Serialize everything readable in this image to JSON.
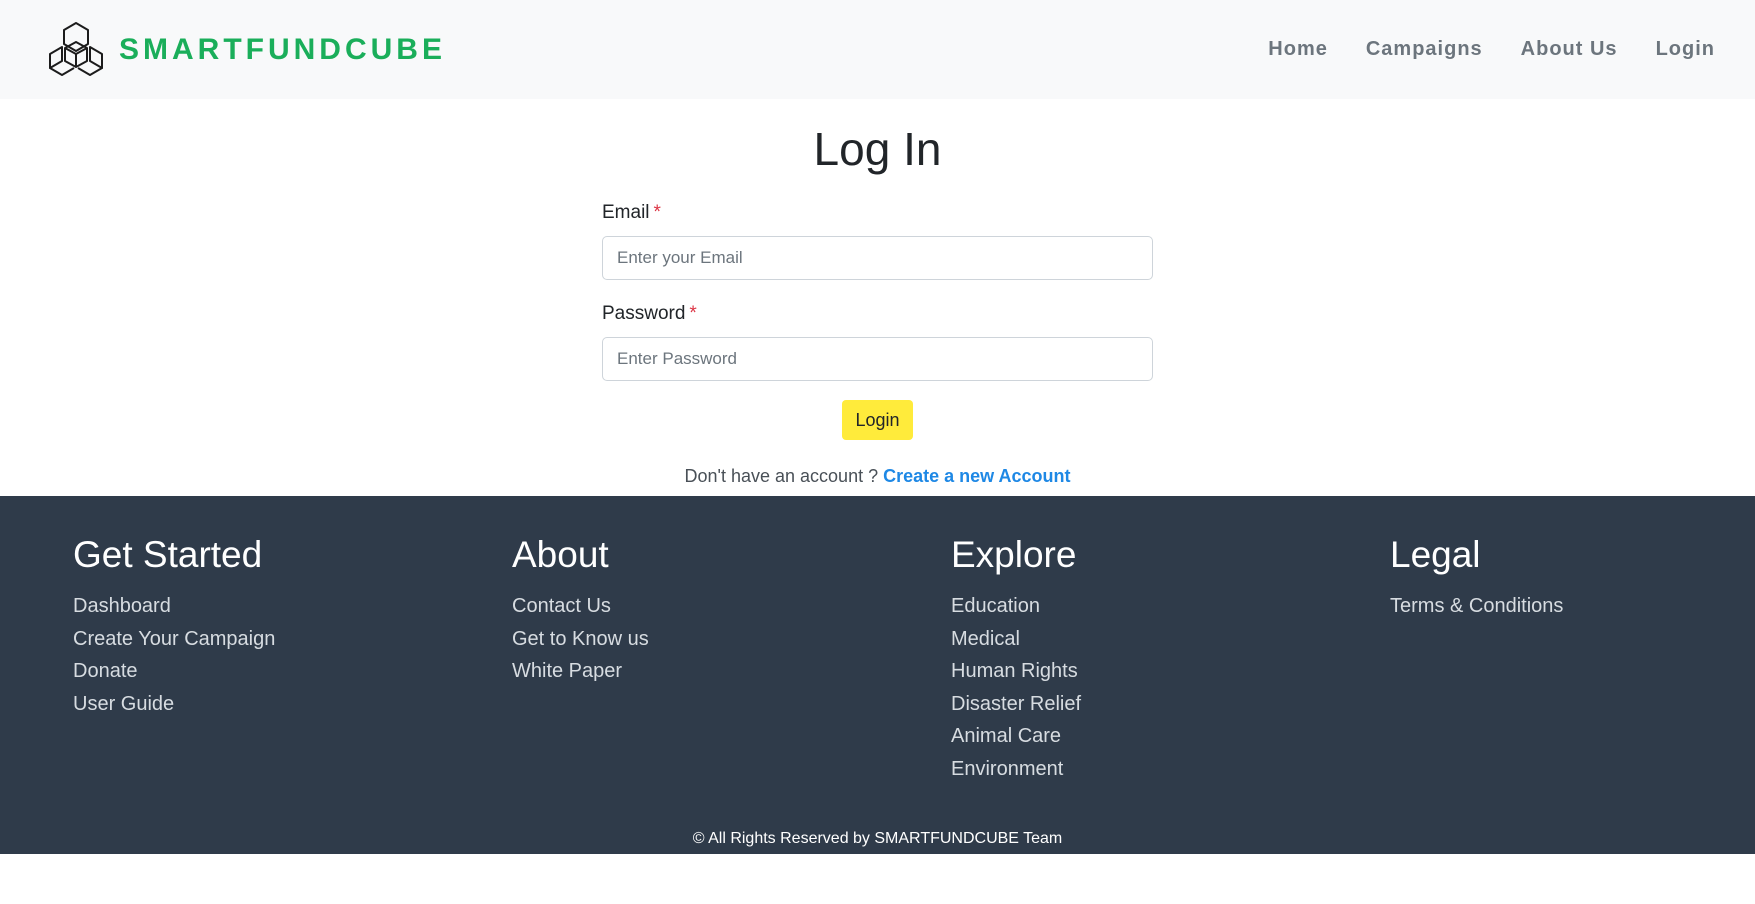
{
  "navbar": {
    "brand_name": "SMARTFUNDCUBE",
    "links": [
      "Home",
      "Campaigns",
      "About Us",
      "Login"
    ]
  },
  "login": {
    "title": "Log In",
    "email": {
      "label": "Email",
      "required_mark": "*",
      "placeholder": "Enter your Email",
      "value": ""
    },
    "password": {
      "label": "Password",
      "required_mark": "*",
      "placeholder": "Enter Password",
      "value": ""
    },
    "submit_label": "Login",
    "signup_prompt": "Don't have an account ? ",
    "signup_link": "Create a new Account"
  },
  "footer": {
    "columns": [
      {
        "heading": "Get Started",
        "items": [
          "Dashboard",
          "Create Your Campaign",
          "Donate",
          "User Guide"
        ]
      },
      {
        "heading": "About",
        "items": [
          "Contact Us",
          "Get to Know us",
          "White Paper"
        ]
      },
      {
        "heading": "Explore",
        "items": [
          "Education",
          "Medical",
          "Human Rights",
          "Disaster Relief",
          "Animal Care",
          "Environment"
        ]
      },
      {
        "heading": "Legal",
        "items": [
          "Terms & Conditions"
        ]
      }
    ],
    "copyright": "© All Rights Reserved by SMARTFUNDCUBE Team"
  },
  "colors": {
    "brand_green": "#1aae5a",
    "navbar_bg": "#f8f9fa",
    "footer_bg": "#2f3b4a",
    "login_button_bg": "#ffeb3b",
    "link_blue": "#1e88e5",
    "required_red": "#dc3545"
  },
  "icons": {
    "brand_logo": "hexagon-cube-icon"
  }
}
